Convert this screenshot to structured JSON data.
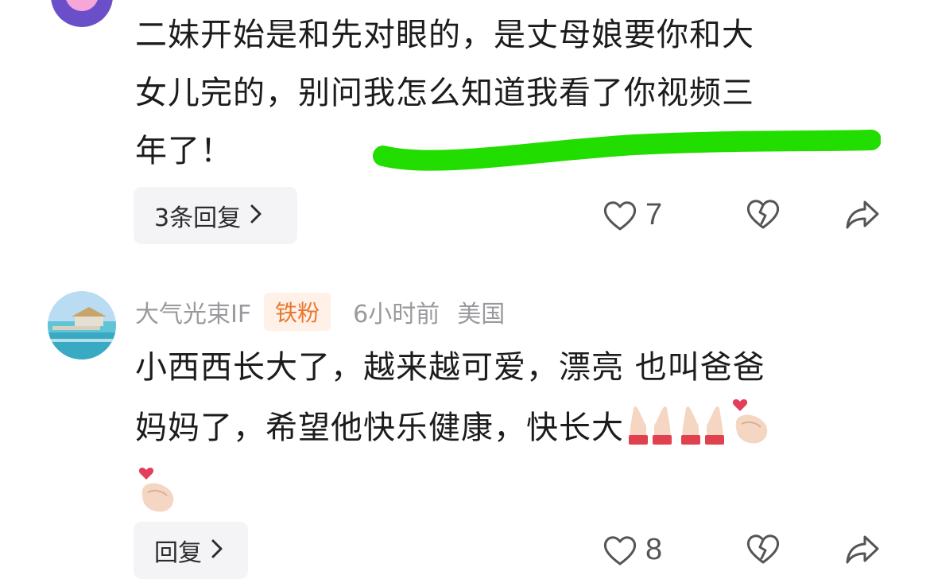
{
  "comment1": {
    "text_lines": [
      "二妹开始是和先对眼的，是丈母娘要你和大",
      "女儿完的，别问我怎么知道我看了你视频三",
      "年了！"
    ],
    "reply_label": "3条回复",
    "like_count": "7",
    "icons": {
      "avatar": "avatar-image",
      "like": "heart-icon",
      "dislike": "broken-heart-icon",
      "share": "share-arrow-icon",
      "more": "chevron-right-icon"
    },
    "highlight_color": "#22dd00"
  },
  "comment2": {
    "username": "大气光束IF",
    "badge": "铁粉",
    "time": "6小时前",
    "location": "美国",
    "text_lines": [
      "小西西长大了，越来越可爱，漂亮 也叫爸爸",
      "妈妈了，希望他快乐健康，快长大"
    ],
    "emojis": [
      "praying-hands-emoji",
      "praying-hands-emoji",
      "finger-heart-emoji",
      "finger-heart-emoji"
    ],
    "reply_label": "回复",
    "like_count": "8",
    "icons": {
      "like": "heart-icon",
      "dislike": "broken-heart-icon",
      "share": "share-arrow-icon",
      "more": "chevron-right-icon"
    },
    "badge_color": "#e8782f"
  }
}
